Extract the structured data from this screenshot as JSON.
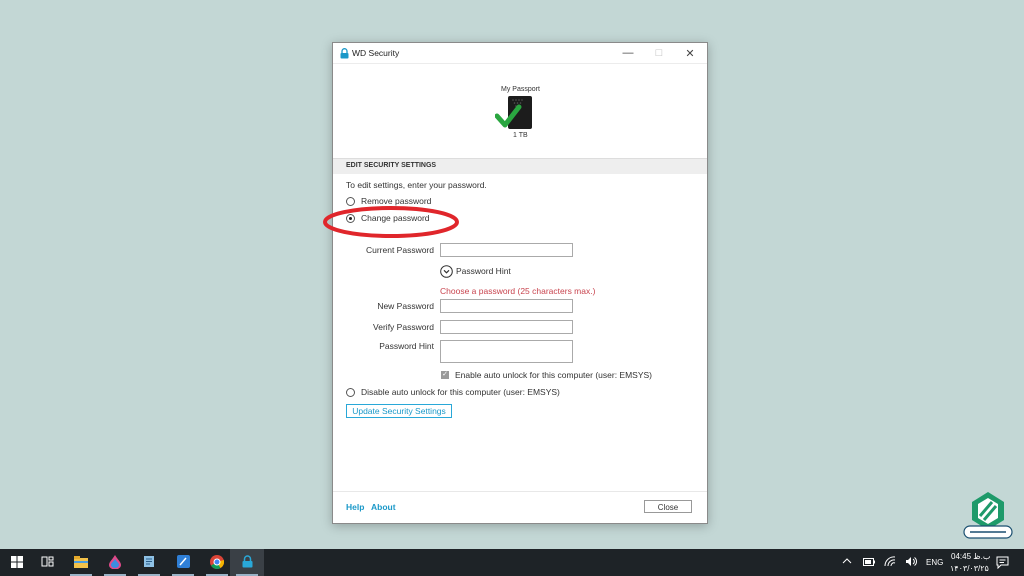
{
  "window": {
    "title": "WD Security"
  },
  "device": {
    "name": "My Passport",
    "capacity": "1 TB"
  },
  "section": {
    "title": "EDIT SECURITY SETTINGS"
  },
  "form": {
    "instruction": "To edit settings, enter your password.",
    "option_remove": "Remove password",
    "option_change": "Change password",
    "current_password_label": "Current Password",
    "password_hint_toggle": "Password Hint",
    "password_note": "Choose a password (25 characters max.)",
    "new_password_label": "New Password",
    "verify_password_label": "Verify Password",
    "password_hint_label": "Password Hint",
    "auto_unlock_checkbox_label": "Enable auto unlock for this computer (user: EMSYS)",
    "disable_auto_unlock_label": "Disable auto unlock for this computer (user: EMSYS)",
    "update_button": "Update Security Settings"
  },
  "footer": {
    "help": "Help",
    "about": "About",
    "close": "Close"
  },
  "taskbar": {
    "language": "ENG",
    "time": "04:45 ب.ظ",
    "date": "۱۴۰۳/۰۳/۲۵"
  },
  "colors": {
    "desktop": "#c3d7d5",
    "accent_blue": "#1a98c8",
    "note_red": "#c8444e",
    "annotation_red": "#e0262b",
    "check_green": "#2aa640"
  }
}
